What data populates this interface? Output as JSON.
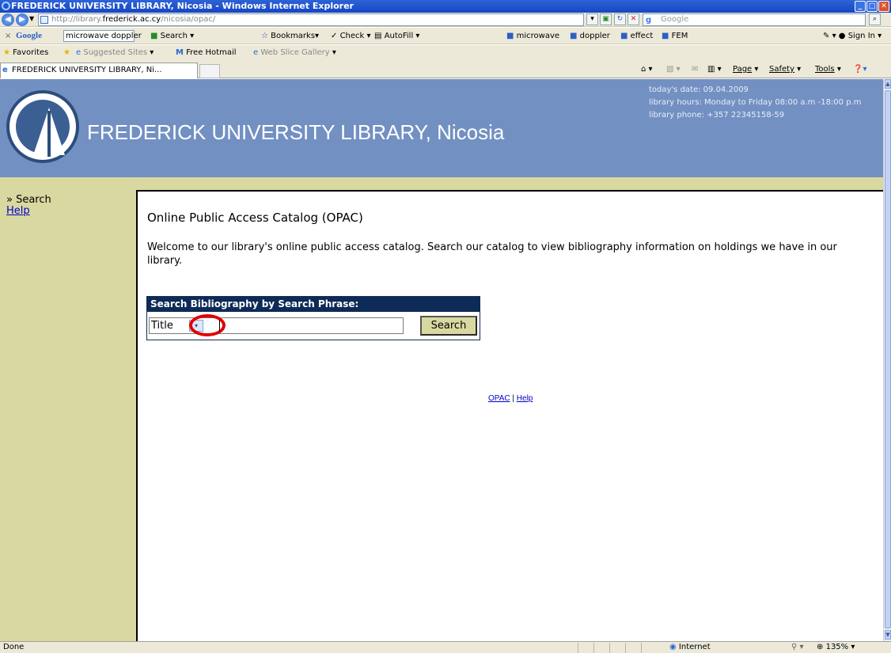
{
  "window": {
    "title": "FREDERICK UNIVERSITY LIBRARY, Nicosia - Windows Internet Explorer",
    "controls": [
      "_",
      "□",
      "✕"
    ]
  },
  "addressbar": {
    "url_prefix": "http://library.",
    "url_host": "frederick.ac.cy",
    "url_path": "/nicosia/opac/",
    "search_provider": "Google"
  },
  "google_toolbar": {
    "close": "×",
    "brand": "Google",
    "query": "microwave doppler",
    "search": "Search",
    "bookmarks": "Bookmarks",
    "check": "Check",
    "autofill": "AutoFill",
    "chips": [
      "microwave",
      "doppler",
      "effect",
      "FEM"
    ],
    "sign_in": "Sign In"
  },
  "favorites_bar": {
    "favorites": "Favorites",
    "suggested": "Suggested Sites",
    "hotmail": "Free Hotmail",
    "webslice": "Web Slice Gallery"
  },
  "tab": {
    "label": "FREDERICK UNIVERSITY LIBRARY, Ni..."
  },
  "command_bar": {
    "page": "Page",
    "safety": "Safety",
    "tools": "Tools"
  },
  "header": {
    "title": "FREDERICK UNIVERSITY LIBRARY, Nicosia",
    "date_line": "today's date: 09.04.2009",
    "hours_line": "library hours:  Monday to Friday 08:00 a.m -18:00 p.m",
    "phone_line": "library phone: +357 22345158-59"
  },
  "sidebar": {
    "search": "» Search",
    "help": "Help"
  },
  "content": {
    "heading": "Online Public Access Catalog (OPAC)",
    "welcome": "Welcome to our library's online public access catalog. Search our catalog to view bibliography information on holdings we have in our library.",
    "search_box": {
      "title": "Search Bibliography by Search Phrase:",
      "field_selected": "Title",
      "query_value": "",
      "button": "Search"
    },
    "footer_links": [
      "OPAC",
      "Help"
    ],
    "footer_separator": "|"
  },
  "statusbar": {
    "status": "Done",
    "zone": "Internet",
    "zoom": "135%"
  }
}
